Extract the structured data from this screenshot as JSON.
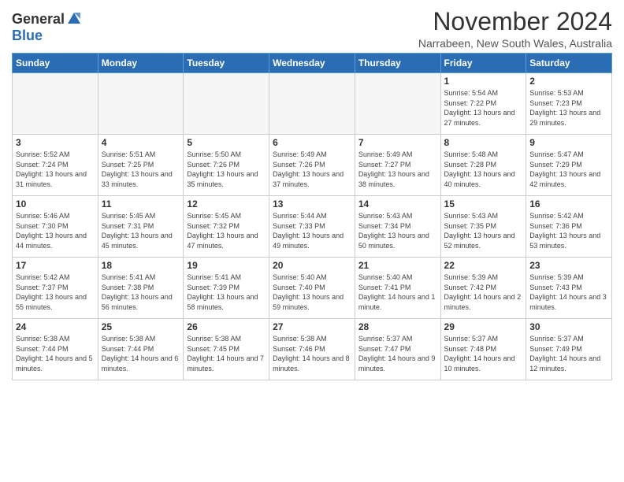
{
  "logo": {
    "general": "General",
    "blue": "Blue"
  },
  "header": {
    "month": "November 2024",
    "location": "Narrabeen, New South Wales, Australia"
  },
  "weekdays": [
    "Sunday",
    "Monday",
    "Tuesday",
    "Wednesday",
    "Thursday",
    "Friday",
    "Saturday"
  ],
  "weeks": [
    [
      {
        "day": "",
        "sunrise": "",
        "sunset": "",
        "daylight": "",
        "empty": true
      },
      {
        "day": "",
        "sunrise": "",
        "sunset": "",
        "daylight": "",
        "empty": true
      },
      {
        "day": "",
        "sunrise": "",
        "sunset": "",
        "daylight": "",
        "empty": true
      },
      {
        "day": "",
        "sunrise": "",
        "sunset": "",
        "daylight": "",
        "empty": true
      },
      {
        "day": "",
        "sunrise": "",
        "sunset": "",
        "daylight": "",
        "empty": true
      },
      {
        "day": "1",
        "sunrise": "Sunrise: 5:54 AM",
        "sunset": "Sunset: 7:22 PM",
        "daylight": "Daylight: 13 hours and 27 minutes.",
        "empty": false
      },
      {
        "day": "2",
        "sunrise": "Sunrise: 5:53 AM",
        "sunset": "Sunset: 7:23 PM",
        "daylight": "Daylight: 13 hours and 29 minutes.",
        "empty": false
      }
    ],
    [
      {
        "day": "3",
        "sunrise": "Sunrise: 5:52 AM",
        "sunset": "Sunset: 7:24 PM",
        "daylight": "Daylight: 13 hours and 31 minutes.",
        "empty": false
      },
      {
        "day": "4",
        "sunrise": "Sunrise: 5:51 AM",
        "sunset": "Sunset: 7:25 PM",
        "daylight": "Daylight: 13 hours and 33 minutes.",
        "empty": false
      },
      {
        "day": "5",
        "sunrise": "Sunrise: 5:50 AM",
        "sunset": "Sunset: 7:26 PM",
        "daylight": "Daylight: 13 hours and 35 minutes.",
        "empty": false
      },
      {
        "day": "6",
        "sunrise": "Sunrise: 5:49 AM",
        "sunset": "Sunset: 7:26 PM",
        "daylight": "Daylight: 13 hours and 37 minutes.",
        "empty": false
      },
      {
        "day": "7",
        "sunrise": "Sunrise: 5:49 AM",
        "sunset": "Sunset: 7:27 PM",
        "daylight": "Daylight: 13 hours and 38 minutes.",
        "empty": false
      },
      {
        "day": "8",
        "sunrise": "Sunrise: 5:48 AM",
        "sunset": "Sunset: 7:28 PM",
        "daylight": "Daylight: 13 hours and 40 minutes.",
        "empty": false
      },
      {
        "day": "9",
        "sunrise": "Sunrise: 5:47 AM",
        "sunset": "Sunset: 7:29 PM",
        "daylight": "Daylight: 13 hours and 42 minutes.",
        "empty": false
      }
    ],
    [
      {
        "day": "10",
        "sunrise": "Sunrise: 5:46 AM",
        "sunset": "Sunset: 7:30 PM",
        "daylight": "Daylight: 13 hours and 44 minutes.",
        "empty": false
      },
      {
        "day": "11",
        "sunrise": "Sunrise: 5:45 AM",
        "sunset": "Sunset: 7:31 PM",
        "daylight": "Daylight: 13 hours and 45 minutes.",
        "empty": false
      },
      {
        "day": "12",
        "sunrise": "Sunrise: 5:45 AM",
        "sunset": "Sunset: 7:32 PM",
        "daylight": "Daylight: 13 hours and 47 minutes.",
        "empty": false
      },
      {
        "day": "13",
        "sunrise": "Sunrise: 5:44 AM",
        "sunset": "Sunset: 7:33 PM",
        "daylight": "Daylight: 13 hours and 49 minutes.",
        "empty": false
      },
      {
        "day": "14",
        "sunrise": "Sunrise: 5:43 AM",
        "sunset": "Sunset: 7:34 PM",
        "daylight": "Daylight: 13 hours and 50 minutes.",
        "empty": false
      },
      {
        "day": "15",
        "sunrise": "Sunrise: 5:43 AM",
        "sunset": "Sunset: 7:35 PM",
        "daylight": "Daylight: 13 hours and 52 minutes.",
        "empty": false
      },
      {
        "day": "16",
        "sunrise": "Sunrise: 5:42 AM",
        "sunset": "Sunset: 7:36 PM",
        "daylight": "Daylight: 13 hours and 53 minutes.",
        "empty": false
      }
    ],
    [
      {
        "day": "17",
        "sunrise": "Sunrise: 5:42 AM",
        "sunset": "Sunset: 7:37 PM",
        "daylight": "Daylight: 13 hours and 55 minutes.",
        "empty": false
      },
      {
        "day": "18",
        "sunrise": "Sunrise: 5:41 AM",
        "sunset": "Sunset: 7:38 PM",
        "daylight": "Daylight: 13 hours and 56 minutes.",
        "empty": false
      },
      {
        "day": "19",
        "sunrise": "Sunrise: 5:41 AM",
        "sunset": "Sunset: 7:39 PM",
        "daylight": "Daylight: 13 hours and 58 minutes.",
        "empty": false
      },
      {
        "day": "20",
        "sunrise": "Sunrise: 5:40 AM",
        "sunset": "Sunset: 7:40 PM",
        "daylight": "Daylight: 13 hours and 59 minutes.",
        "empty": false
      },
      {
        "day": "21",
        "sunrise": "Sunrise: 5:40 AM",
        "sunset": "Sunset: 7:41 PM",
        "daylight": "Daylight: 14 hours and 1 minute.",
        "empty": false
      },
      {
        "day": "22",
        "sunrise": "Sunrise: 5:39 AM",
        "sunset": "Sunset: 7:42 PM",
        "daylight": "Daylight: 14 hours and 2 minutes.",
        "empty": false
      },
      {
        "day": "23",
        "sunrise": "Sunrise: 5:39 AM",
        "sunset": "Sunset: 7:43 PM",
        "daylight": "Daylight: 14 hours and 3 minutes.",
        "empty": false
      }
    ],
    [
      {
        "day": "24",
        "sunrise": "Sunrise: 5:38 AM",
        "sunset": "Sunset: 7:44 PM",
        "daylight": "Daylight: 14 hours and 5 minutes.",
        "empty": false
      },
      {
        "day": "25",
        "sunrise": "Sunrise: 5:38 AM",
        "sunset": "Sunset: 7:44 PM",
        "daylight": "Daylight: 14 hours and 6 minutes.",
        "empty": false
      },
      {
        "day": "26",
        "sunrise": "Sunrise: 5:38 AM",
        "sunset": "Sunset: 7:45 PM",
        "daylight": "Daylight: 14 hours and 7 minutes.",
        "empty": false
      },
      {
        "day": "27",
        "sunrise": "Sunrise: 5:38 AM",
        "sunset": "Sunset: 7:46 PM",
        "daylight": "Daylight: 14 hours and 8 minutes.",
        "empty": false
      },
      {
        "day": "28",
        "sunrise": "Sunrise: 5:37 AM",
        "sunset": "Sunset: 7:47 PM",
        "daylight": "Daylight: 14 hours and 9 minutes.",
        "empty": false
      },
      {
        "day": "29",
        "sunrise": "Sunrise: 5:37 AM",
        "sunset": "Sunset: 7:48 PM",
        "daylight": "Daylight: 14 hours and 10 minutes.",
        "empty": false
      },
      {
        "day": "30",
        "sunrise": "Sunrise: 5:37 AM",
        "sunset": "Sunset: 7:49 PM",
        "daylight": "Daylight: 14 hours and 12 minutes.",
        "empty": false
      }
    ]
  ]
}
